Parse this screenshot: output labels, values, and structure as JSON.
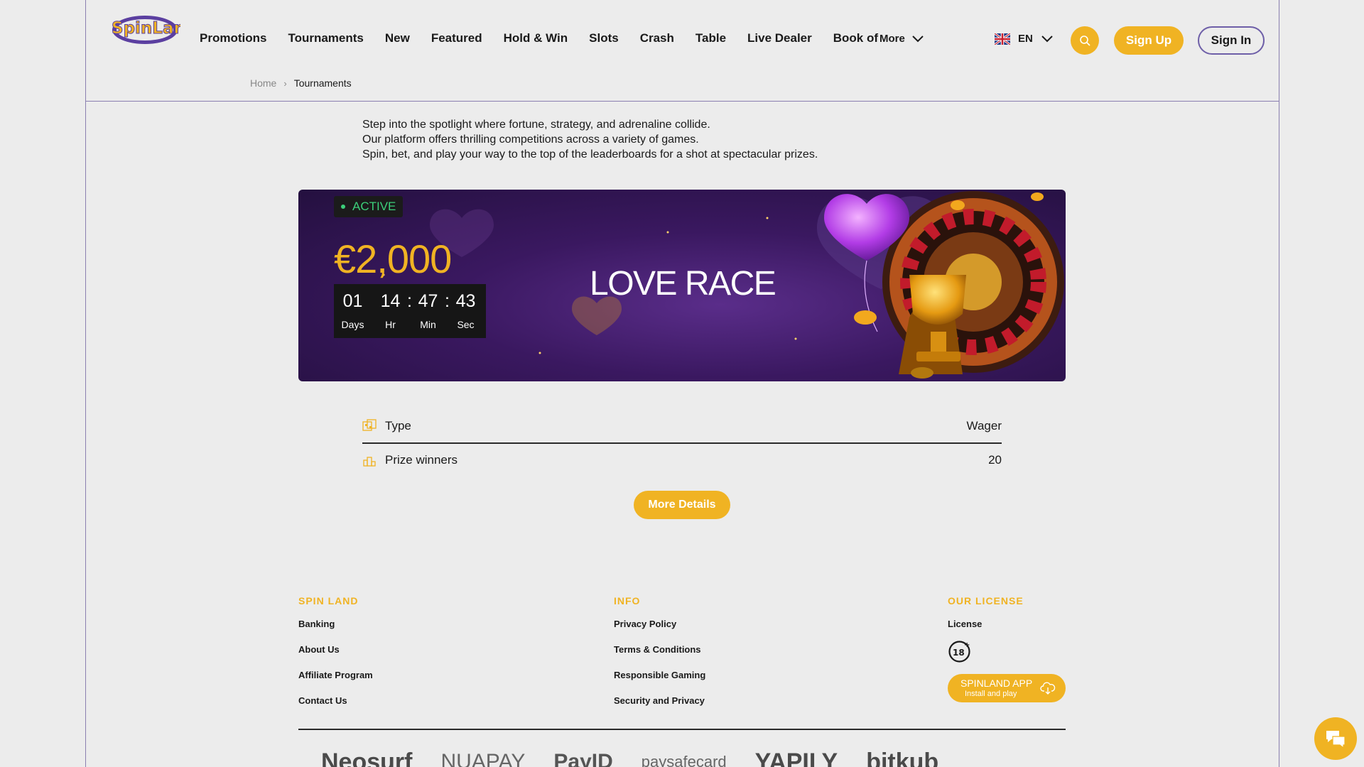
{
  "header": {
    "nav": [
      "Promotions",
      "Tournaments",
      "New",
      "Featured",
      "Hold & Win",
      "Slots",
      "Crash",
      "Table",
      "Live Dealer",
      "Book of"
    ],
    "more_label": "More",
    "lang_label": "EN",
    "signup_label": "Sign Up",
    "signin_label": "Sign In",
    "logo_text": "SpinLand"
  },
  "breadcrumb": {
    "home": "Home",
    "current": "Tournaments"
  },
  "intro": {
    "line1": "Step into the spotlight where fortune, strategy, and adrenaline collide.",
    "line2": "Our platform offers thrilling competitions across a variety of games.",
    "line3": "Spin, bet, and play your way to the top of the leaderboards for a shot at spectacular prizes."
  },
  "tournament": {
    "status": "ACTIVE",
    "prize": "€2,000",
    "title": "LOVE RACE",
    "timer": {
      "days": "01",
      "days_label": "Days",
      "hours": "14",
      "hours_label": "Hr",
      "minutes": "47",
      "minutes_label": "Min",
      "seconds": "43",
      "seconds_label": "Sec"
    },
    "type_label": "Type",
    "type_value": "Wager",
    "winners_label": "Prize winners",
    "winners_value": "20",
    "details_button": "More Details"
  },
  "footer": {
    "spin_land": {
      "heading": "SPIN LAND",
      "links": [
        "Banking",
        "About Us",
        "Affiliate Program",
        "Contact Us"
      ]
    },
    "info": {
      "heading": "INFO",
      "links": [
        "Privacy Policy",
        "Terms & Conditions",
        "Responsible Gaming",
        "Security and Privacy"
      ]
    },
    "license": {
      "heading": "OUR LICENSE",
      "link": "License",
      "age": "18+"
    },
    "app": {
      "title": "SPINLAND APP",
      "subtitle": "Install and play"
    },
    "payments": [
      "Neosurf",
      "NUAPAY",
      "PayID",
      "paysafecard",
      "YAPILY",
      "bitkub"
    ]
  },
  "colors": {
    "accent": "#f0b323",
    "brand_purple": "#6e5fa8",
    "active_green": "#3ccf7a"
  }
}
